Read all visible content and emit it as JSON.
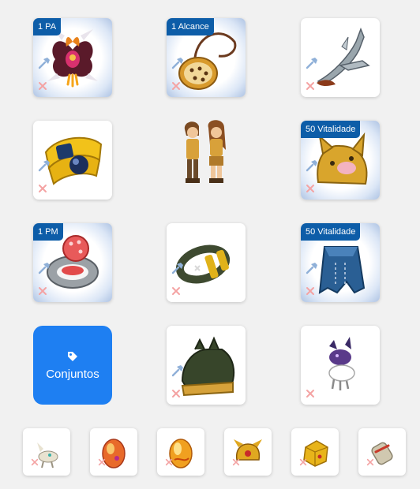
{
  "slots": {
    "amulet": {
      "badge": "1 PA"
    },
    "necklace": {
      "badge": "1 Alcance"
    },
    "weapon": {
      "badge": ""
    },
    "belt": {
      "badge": ""
    },
    "hat": {
      "badge": "50 Vitalidade"
    },
    "ring_left": {
      "badge": "1 PM"
    },
    "ring_right": {
      "badge": ""
    },
    "cape": {
      "badge": "50 Vitalidade"
    },
    "boots": {
      "badge": ""
    },
    "pet": {
      "badge": ""
    }
  },
  "sets_button": {
    "label": "Conjuntos",
    "icon": "tag-icon"
  },
  "colors": {
    "badge": "#0d5da8",
    "accent": "#1e7ff2",
    "remove": "#f4a3a3",
    "edit": "#8fb0d8"
  }
}
